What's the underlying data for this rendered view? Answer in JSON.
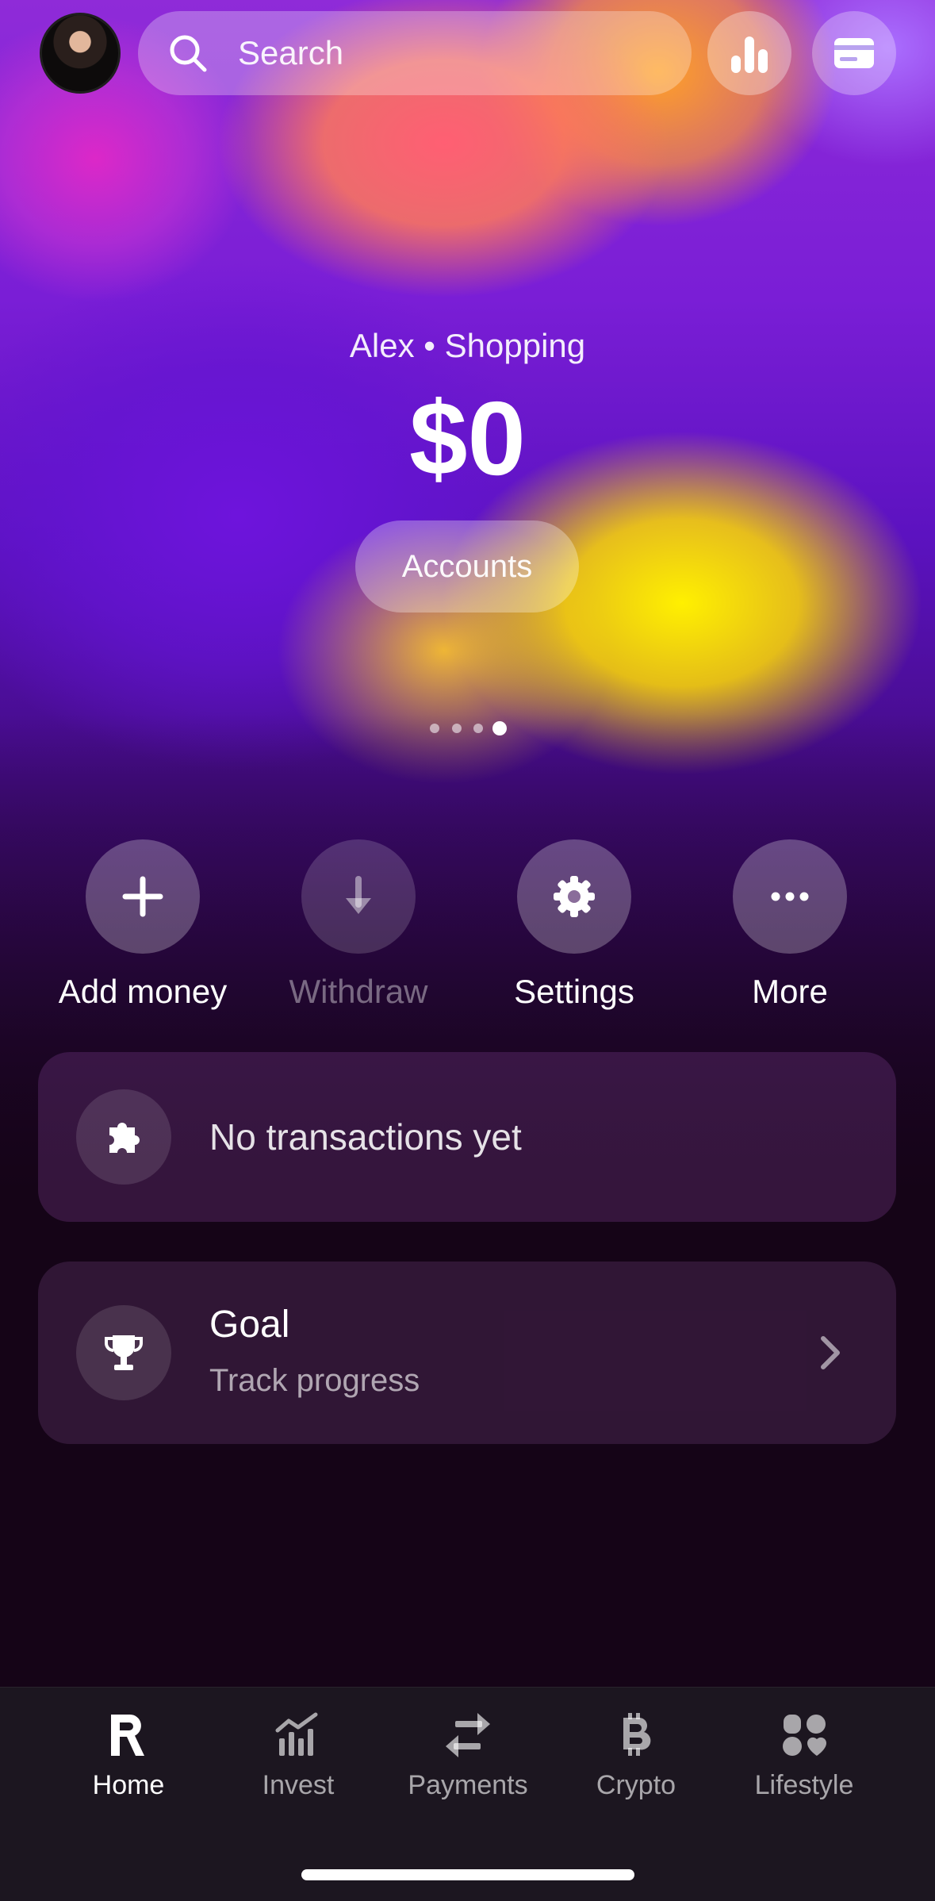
{
  "search": {
    "placeholder": "Search"
  },
  "account": {
    "subtitle": "Alex • Shopping",
    "balance": "$0",
    "accounts_button": "Accounts",
    "page_count": 4,
    "active_page": 4
  },
  "actions": [
    {
      "label": "Add money",
      "icon": "plus-icon",
      "enabled": true
    },
    {
      "label": "Withdraw",
      "icon": "arrow-down-icon",
      "enabled": false
    },
    {
      "label": "Settings",
      "icon": "gear-icon",
      "enabled": true
    },
    {
      "label": "More",
      "icon": "ellipsis-icon",
      "enabled": true
    }
  ],
  "transactions": {
    "empty_text": "No transactions yet",
    "icon": "puzzle-icon"
  },
  "goal": {
    "title": "Goal",
    "subtitle": "Track progress",
    "icon": "trophy-icon"
  },
  "tabs": [
    {
      "label": "Home",
      "icon": "revolut-r-icon",
      "active": true
    },
    {
      "label": "Invest",
      "icon": "chart-icon",
      "active": false
    },
    {
      "label": "Payments",
      "icon": "transfer-arrows-icon",
      "active": false
    },
    {
      "label": "Crypto",
      "icon": "bitcoin-icon",
      "active": false
    },
    {
      "label": "Lifestyle",
      "icon": "lifestyle-icon",
      "active": false
    }
  ]
}
